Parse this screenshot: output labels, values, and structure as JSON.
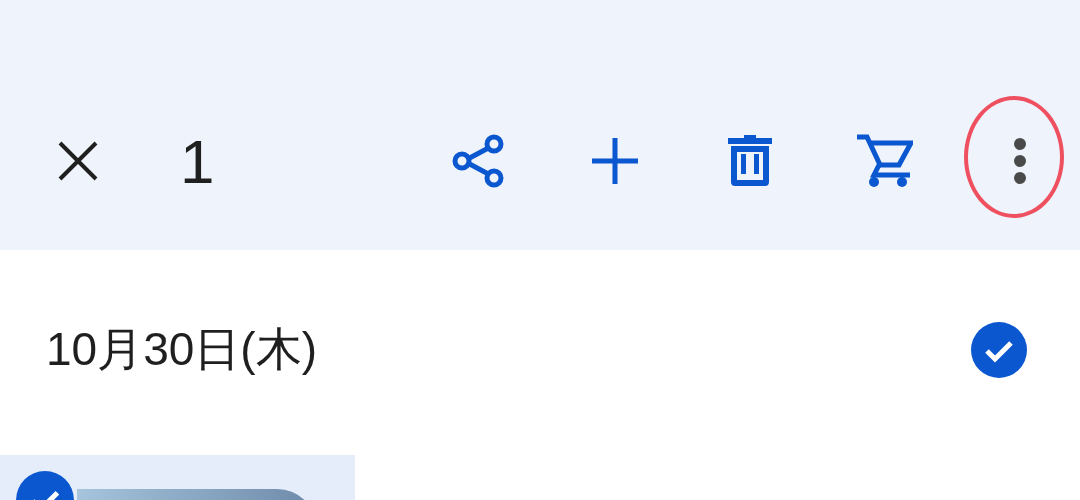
{
  "toolbar": {
    "selected_count": "1"
  },
  "date_group": {
    "date": "10月30日(木)",
    "selected": true
  },
  "photos": [
    {
      "selected": true
    }
  ]
}
